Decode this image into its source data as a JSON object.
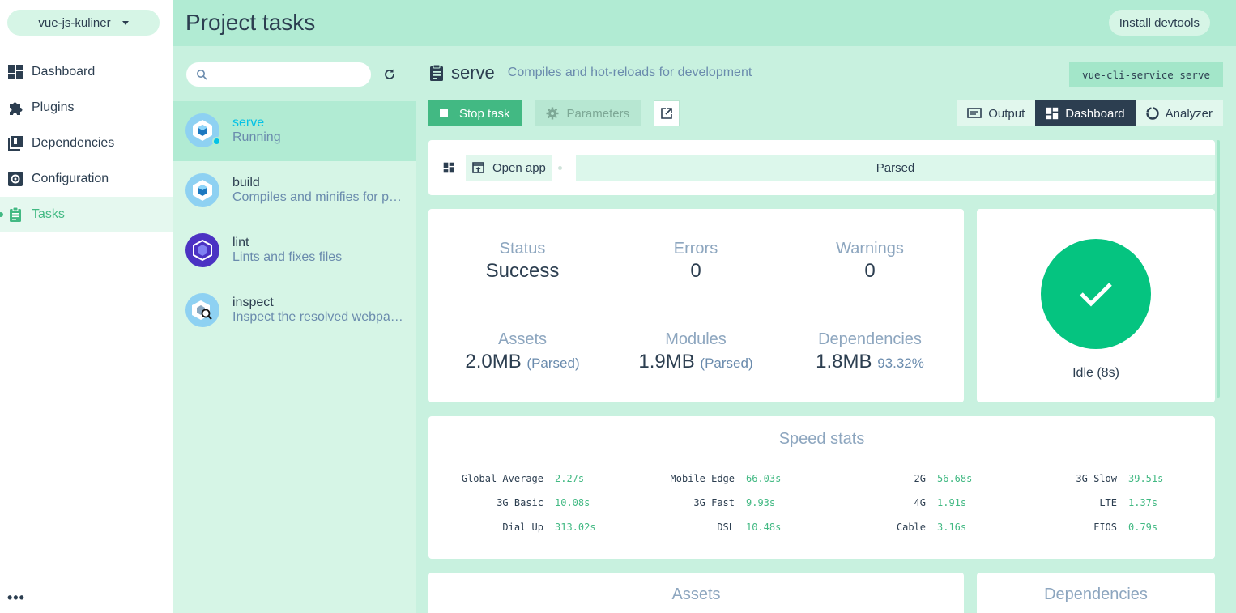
{
  "nav": {
    "project": "vue-js-kuliner",
    "items": [
      {
        "label": "Dashboard"
      },
      {
        "label": "Plugins"
      },
      {
        "label": "Dependencies"
      },
      {
        "label": "Configuration"
      },
      {
        "label": "Tasks"
      }
    ],
    "more": "•••"
  },
  "header": {
    "title": "Project tasks",
    "devtools": "Install devtools"
  },
  "tasks": {
    "search_placeholder": "",
    "items": [
      {
        "name": "serve",
        "desc": "Running"
      },
      {
        "name": "build",
        "desc": "Compiles and minifies for production"
      },
      {
        "name": "lint",
        "desc": "Lints and fixes files"
      },
      {
        "name": "inspect",
        "desc": "Inspect the resolved webpack config"
      }
    ]
  },
  "main": {
    "task_name": "serve",
    "task_desc": "Compiles and hot-reloads for development",
    "command": "vue-cli-service serve",
    "stop": "Stop task",
    "params": "Parameters",
    "views": {
      "output": "Output",
      "dashboard": "Dashboard",
      "analyzer": "Analyzer"
    },
    "open_app": "Open app",
    "parsed": "Parsed",
    "stats": {
      "status_label": "Status",
      "status": "Success",
      "errors_label": "Errors",
      "errors": "0",
      "warnings_label": "Warnings",
      "warnings": "0",
      "assets_label": "Assets",
      "assets": "2.0MB",
      "assets_note": "(Parsed)",
      "modules_label": "Modules",
      "modules": "1.9MB",
      "modules_note": "(Parsed)",
      "deps_label": "Dependencies",
      "deps": "1.8MB",
      "deps_note": "93.32%"
    },
    "idle": "Idle (8s)",
    "speed": {
      "title": "Speed stats",
      "rows": [
        [
          {
            "k": "Global Average",
            "v": "2.27s"
          },
          {
            "k": "Mobile Edge",
            "v": "66.03s"
          },
          {
            "k": "2G",
            "v": "56.68s"
          },
          {
            "k": "3G Slow",
            "v": "39.51s"
          }
        ],
        [
          {
            "k": "3G Basic",
            "v": "10.08s"
          },
          {
            "k": "3G Fast",
            "v": "9.93s"
          },
          {
            "k": "4G",
            "v": "1.91s"
          },
          {
            "k": "LTE",
            "v": "1.37s"
          }
        ],
        [
          {
            "k": "Dial Up",
            "v": "313.02s"
          },
          {
            "k": "DSL",
            "v": "10.48s"
          },
          {
            "k": "Cable",
            "v": "3.16s"
          },
          {
            "k": "FIOS",
            "v": "0.79s"
          }
        ]
      ]
    },
    "assets_title": "Assets",
    "deps_title": "Dependencies"
  },
  "colors": {
    "accent": "#42b983",
    "running": "#03c2e6",
    "success": "#05c480"
  }
}
